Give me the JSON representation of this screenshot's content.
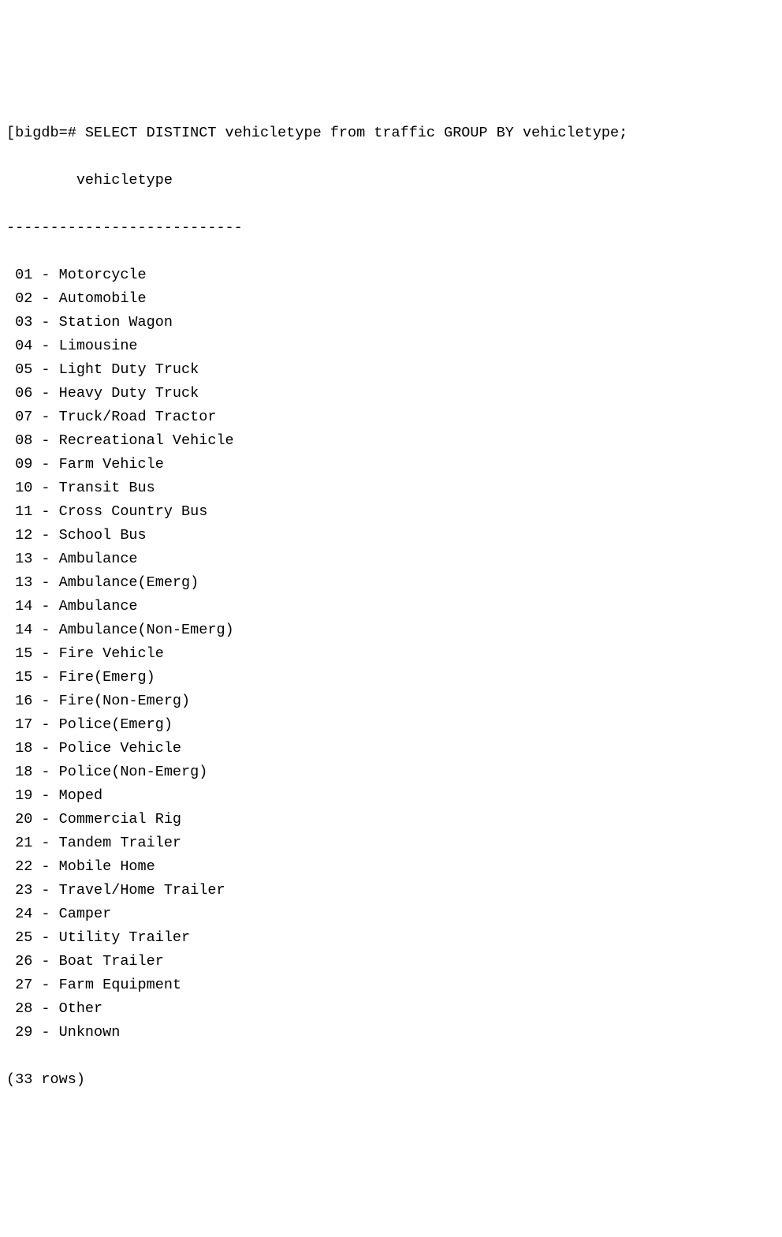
{
  "prompt_prefix": "[bigdb=# ",
  "query": "SELECT DISTINCT vehicletype from traffic GROUP BY vehicletype;",
  "column_header": "        vehicletype",
  "separator": "---------------------------",
  "rows": [
    " 01 - Motorcycle",
    " 02 - Automobile",
    " 03 - Station Wagon",
    " 04 - Limousine",
    " 05 - Light Duty Truck",
    " 06 - Heavy Duty Truck",
    " 07 - Truck/Road Tractor",
    " 08 - Recreational Vehicle",
    " 09 - Farm Vehicle",
    " 10 - Transit Bus",
    " 11 - Cross Country Bus",
    " 12 - School Bus",
    " 13 - Ambulance",
    " 13 - Ambulance(Emerg)",
    " 14 - Ambulance",
    " 14 - Ambulance(Non-Emerg)",
    " 15 - Fire Vehicle",
    " 15 - Fire(Emerg)",
    " 16 - Fire(Non-Emerg)",
    " 17 - Police(Emerg)",
    " 18 - Police Vehicle",
    " 18 - Police(Non-Emerg)",
    " 19 - Moped",
    " 20 - Commercial Rig",
    " 21 - Tandem Trailer",
    " 22 - Mobile Home",
    " 23 - Travel/Home Trailer",
    " 24 - Camper",
    " 25 - Utility Trailer",
    " 26 - Boat Trailer",
    " 27 - Farm Equipment",
    " 28 - Other",
    " 29 - Unknown"
  ],
  "row_count_text": "(33 rows)"
}
